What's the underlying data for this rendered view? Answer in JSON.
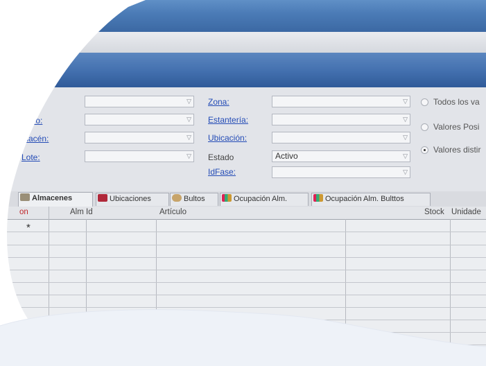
{
  "filters": {
    "left_labels": [
      "",
      "culo:",
      "macén:",
      "Lote:"
    ],
    "middle_labels": [
      "Zona:",
      "Estantería:",
      "Ubicación:"
    ],
    "estado_label": "Estado",
    "estado_value": "Activo",
    "idfase_label": "IdFase:"
  },
  "options": {
    "items": [
      "Todos los va",
      "Valores Posi",
      "Valores distir"
    ],
    "selected_index": 2
  },
  "tabs": [
    {
      "label": "Almacenes",
      "icon": "warehouse-icon",
      "active": true
    },
    {
      "label": "Ubicaciones",
      "icon": "shelf-icon",
      "active": false
    },
    {
      "label": "Bultos",
      "icon": "box-icon",
      "active": false
    },
    {
      "label": "Ocupación Alm.",
      "icon": "occupancy-icon",
      "active": false
    },
    {
      "label": "Ocupación Alm. Bulttos",
      "icon": "occupancy-icon",
      "active": false
    }
  ],
  "grid": {
    "columns": [
      "on",
      "Alm Id",
      "Artículo",
      "Stock",
      "Unidade"
    ],
    "new_row_marker": "*"
  },
  "colors": {
    "title_blue": "#4a7ab5",
    "link_blue": "#234bb6",
    "wave_fill": "#edf1f7"
  }
}
